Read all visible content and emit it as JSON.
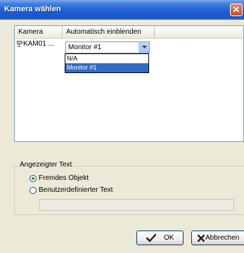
{
  "window": {
    "title": "Kamera wählen",
    "close_glyph": "✕"
  },
  "list": {
    "columns": [
      "Kamera",
      "Automatisch einblenden"
    ],
    "rows": [
      {
        "camera": "KAM01 ...",
        "combo_value": "Monitor #1"
      }
    ]
  },
  "dropdown": {
    "options": [
      "N/A",
      "Monitor #1"
    ],
    "selected_index": 1
  },
  "group": {
    "label": "Angezeigter Text",
    "radio_fremdes": "Fremdes Objekt",
    "radio_benutzer": "Benutzerdefinierter Text",
    "selected": "Fremdes Objekt",
    "custom_text": ""
  },
  "buttons": {
    "ok": "OK",
    "cancel": "Abbrechen"
  }
}
